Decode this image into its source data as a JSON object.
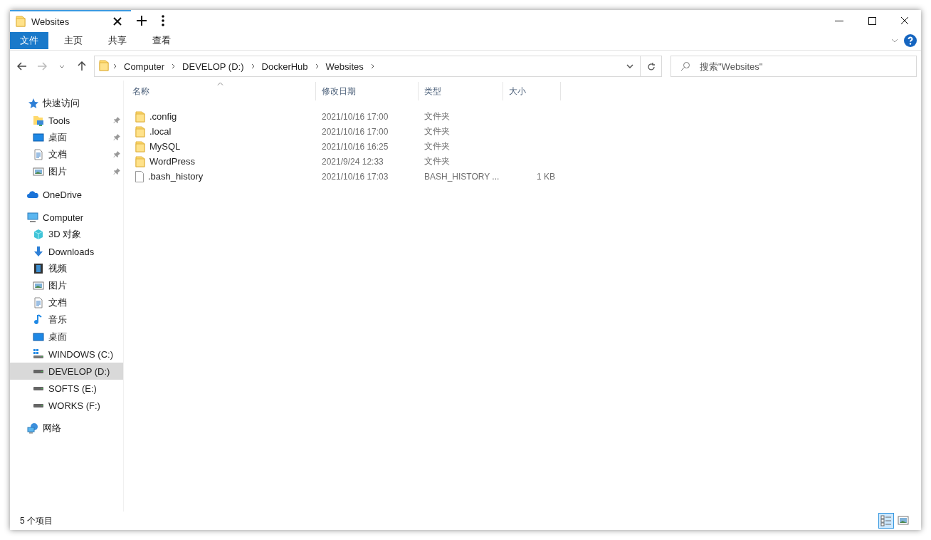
{
  "window": {
    "tab_title": "Websites"
  },
  "ribbon": {
    "tabs": [
      {
        "label": "文件",
        "selected": true
      },
      {
        "label": "主页",
        "selected": false
      },
      {
        "label": "共享",
        "selected": false
      },
      {
        "label": "查看",
        "selected": false
      }
    ]
  },
  "address_bar": {
    "segments": [
      "Computer",
      "DEVELOP (D:)",
      "DockerHub",
      "Websites"
    ],
    "search": {
      "placeholder": "搜索\"Websites\""
    }
  },
  "sidebar": {
    "sections": [
      {
        "label": "快速访问",
        "kind": "star",
        "children": [
          {
            "label": "Tools",
            "kind": "folder-tools",
            "pinned": true,
            "selected": false
          },
          {
            "label": "桌面",
            "kind": "desktop",
            "pinned": true,
            "selected": false
          },
          {
            "label": "文档",
            "kind": "document",
            "pinned": true,
            "selected": false
          },
          {
            "label": "图片",
            "kind": "picture",
            "pinned": true,
            "selected": false
          }
        ]
      },
      {
        "label": "OneDrive",
        "kind": "cloud"
      },
      {
        "label": "Computer",
        "kind": "computer",
        "children": [
          {
            "label": "3D 对象",
            "kind": "cube",
            "pinned": false,
            "selected": false
          },
          {
            "label": "Downloads",
            "kind": "download",
            "pinned": false,
            "selected": false
          },
          {
            "label": "视频",
            "kind": "film",
            "pinned": false,
            "selected": false
          },
          {
            "label": "图片",
            "kind": "picture",
            "pinned": false,
            "selected": false
          },
          {
            "label": "文档",
            "kind": "document",
            "pinned": false,
            "selected": false
          },
          {
            "label": "音乐",
            "kind": "music",
            "pinned": false,
            "selected": false
          },
          {
            "label": "桌面",
            "kind": "desktop",
            "pinned": false,
            "selected": false
          },
          {
            "label": "WINDOWS (C:)",
            "kind": "drive-windows",
            "pinned": false,
            "selected": false
          },
          {
            "label": "DEVELOP (D:)",
            "kind": "drive",
            "pinned": false,
            "selected": true
          },
          {
            "label": "SOFTS (E:)",
            "kind": "drive",
            "pinned": false,
            "selected": false
          },
          {
            "label": "WORKS (F:)",
            "kind": "drive",
            "pinned": false,
            "selected": false
          }
        ]
      },
      {
        "label": "网络",
        "kind": "network"
      }
    ]
  },
  "file_list": {
    "columns": [
      {
        "label": "名称",
        "sorted": true
      },
      {
        "label": "修改日期"
      },
      {
        "label": "类型"
      },
      {
        "label": "大小"
      }
    ],
    "rows": [
      {
        "kind": "folder",
        "name": ".config",
        "modified": "2021/10/16 17:00",
        "type": "文件夹"
      },
      {
        "kind": "folder",
        "name": ".local",
        "modified": "2021/10/16 17:00",
        "type": "文件夹"
      },
      {
        "kind": "folder",
        "name": "MySQL",
        "modified": "2021/10/16 16:25",
        "type": "文件夹"
      },
      {
        "kind": "folder",
        "name": "WordPress",
        "modified": "2021/9/24 12:33",
        "type": "文件夹"
      },
      {
        "kind": "file",
        "name": ".bash_history",
        "modified": "2021/10/16 17:03",
        "type": "BASH_HISTORY ...",
        "size": "1 KB"
      }
    ]
  },
  "status_bar": {
    "item_count": "5 个项目",
    "views": [
      {
        "kind": "details",
        "selected": true
      },
      {
        "kind": "large-icons",
        "selected": false
      }
    ]
  }
}
